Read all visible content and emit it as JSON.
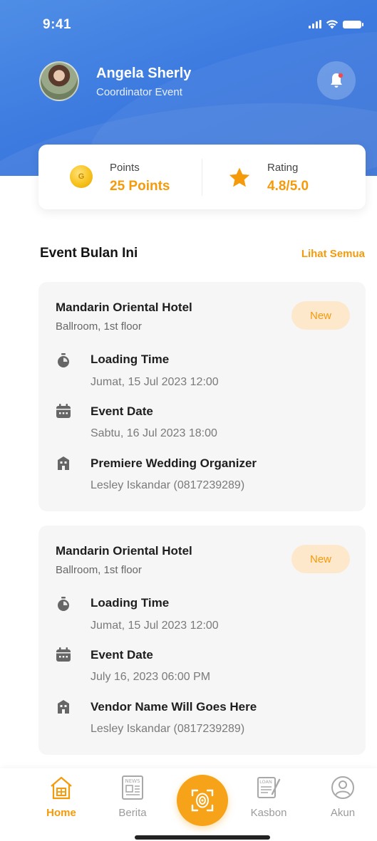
{
  "status_bar": {
    "time": "9:41"
  },
  "profile": {
    "name": "Angela Sherly",
    "role": "Coordinator Event"
  },
  "stats": {
    "points": {
      "label": "Points",
      "value": "25 Points",
      "coin_letter": "G"
    },
    "rating": {
      "label": "Rating",
      "value": "4.8/5.0"
    }
  },
  "section": {
    "title": "Event Bulan Ini",
    "see_all": "Lihat Semua"
  },
  "events": [
    {
      "venue": "Mandarin Oriental Hotel",
      "location": "Ballroom, 1st floor",
      "badge": "New",
      "loading_label": "Loading Time",
      "loading_value": "Jumat, 15 Jul 2023 12:00",
      "date_label": "Event Date",
      "date_value": "Sabtu, 16 Jul 2023 18:00",
      "vendor_name": "Premiere Wedding Organizer",
      "vendor_contact": "Lesley Iskandar (0817239289)"
    },
    {
      "venue": "Mandarin Oriental Hotel",
      "location": "Ballroom, 1st floor",
      "badge": "New",
      "loading_label": "Loading Time",
      "loading_value": "Jumat, 15 Jul 2023 12:00",
      "date_label": "Event Date",
      "date_value": "July 16, 2023 06:00 PM",
      "vendor_name": "Vendor Name Will Goes Here",
      "vendor_contact": "Lesley Iskandar (0817239289)"
    }
  ],
  "nav": {
    "home": "Home",
    "news": "Berita",
    "news_icon_text": "NEWS",
    "cash": "Kasbon",
    "cash_icon_text": "LOAN",
    "account": "Akun"
  },
  "colors": {
    "primary_blue": "#3d7be0",
    "accent_orange": "#f59a0b",
    "badge_bg": "#fde8cc",
    "card_bg": "#f6f6f6"
  }
}
